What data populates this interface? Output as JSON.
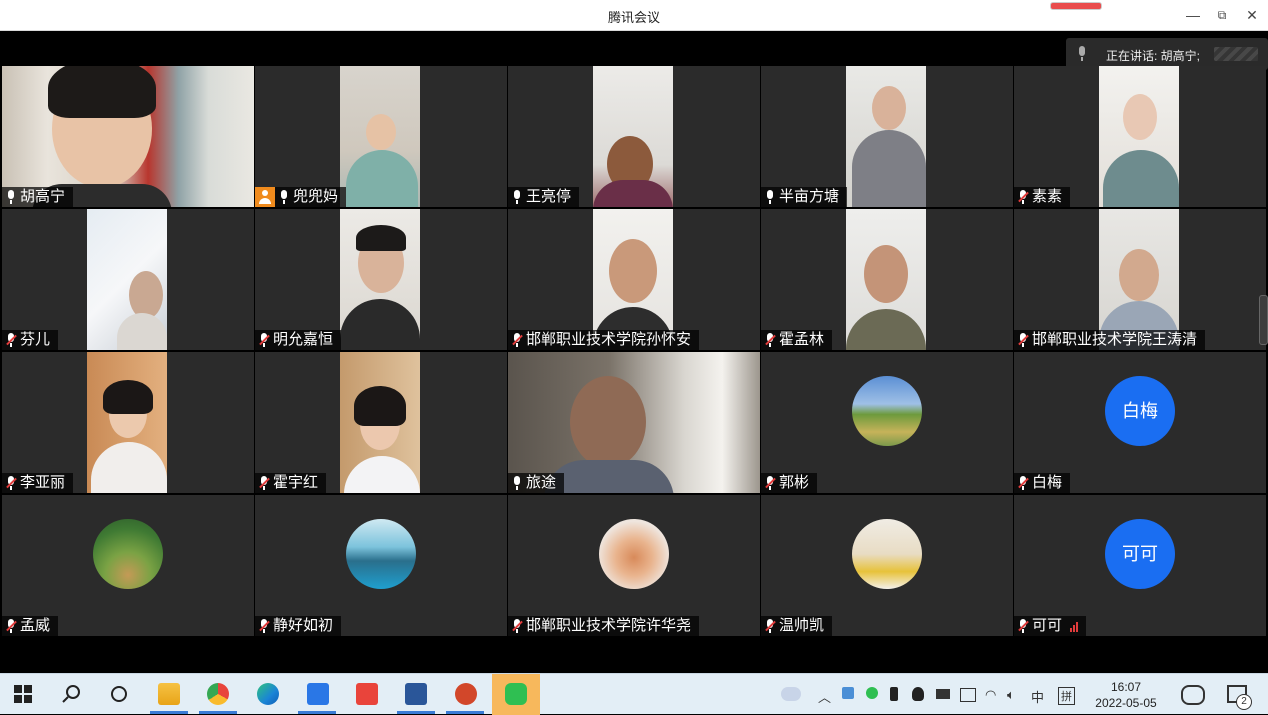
{
  "window": {
    "title": "腾讯会议",
    "min": "—",
    "restore": "⧉",
    "close": "✕"
  },
  "speaking": {
    "text": "正在讲话: 胡高宁;"
  },
  "participants": [
    {
      "name": "胡高宁",
      "muted": false,
      "video": "full",
      "active": true
    },
    {
      "name": "兜兜妈",
      "muted": false,
      "video": "mid",
      "host": true
    },
    {
      "name": "王亮停",
      "muted": false,
      "video": "mid"
    },
    {
      "name": "半亩方塘",
      "muted": false,
      "video": "mid"
    },
    {
      "name": "素素",
      "muted": true,
      "video": "mid"
    },
    {
      "name": "芬儿",
      "muted": true,
      "video": "mid"
    },
    {
      "name": "明允嘉恒",
      "muted": true,
      "video": "mid"
    },
    {
      "name": "邯郸职业技术学院孙怀安",
      "muted": true,
      "video": "mid"
    },
    {
      "name": "霍孟林",
      "muted": true,
      "video": "mid"
    },
    {
      "name": "邯郸职业技术学院王涛清",
      "muted": true,
      "video": "mid"
    },
    {
      "name": "李亚丽",
      "muted": true,
      "video": "mid"
    },
    {
      "name": "霍宇红",
      "muted": true,
      "video": "mid"
    },
    {
      "name": "旅途",
      "muted": false,
      "video": "full"
    },
    {
      "name": "郭彬",
      "muted": true,
      "avatar": "rainbow-landscape"
    },
    {
      "name": "白梅",
      "muted": true,
      "avatar_text": "白梅"
    },
    {
      "name": "孟威",
      "muted": true,
      "avatar": "forest-path"
    },
    {
      "name": "静好如初",
      "muted": true,
      "avatar": "lake-mountains"
    },
    {
      "name": "邯郸职业技术学院许华尧",
      "muted": true,
      "avatar": "baby-photo"
    },
    {
      "name": "温帅凯",
      "muted": true,
      "avatar": "cat-illustration"
    },
    {
      "name": "可可",
      "muted": true,
      "avatar_text": "可可",
      "signal": true
    }
  ],
  "taskbar": {
    "apps": [
      "start-icon",
      "search-icon",
      "task-view-icon",
      "file-explorer-icon",
      "chrome-icon",
      "edge-icon",
      "tencent-meeting-icon",
      "wps-icon",
      "word-icon",
      "powerpoint-icon",
      "wechat-icon"
    ],
    "tray": {
      "ime": "中",
      "ime2": "拼",
      "notification_count": "2"
    },
    "clock": {
      "time": "16:07",
      "date": "2022-05-05"
    }
  },
  "colors": {
    "accent_active": "#3fb58a",
    "avatar_blue": "#1a6ef2",
    "muted_red": "#e23c3c",
    "host_orange": "#f08b1d"
  }
}
